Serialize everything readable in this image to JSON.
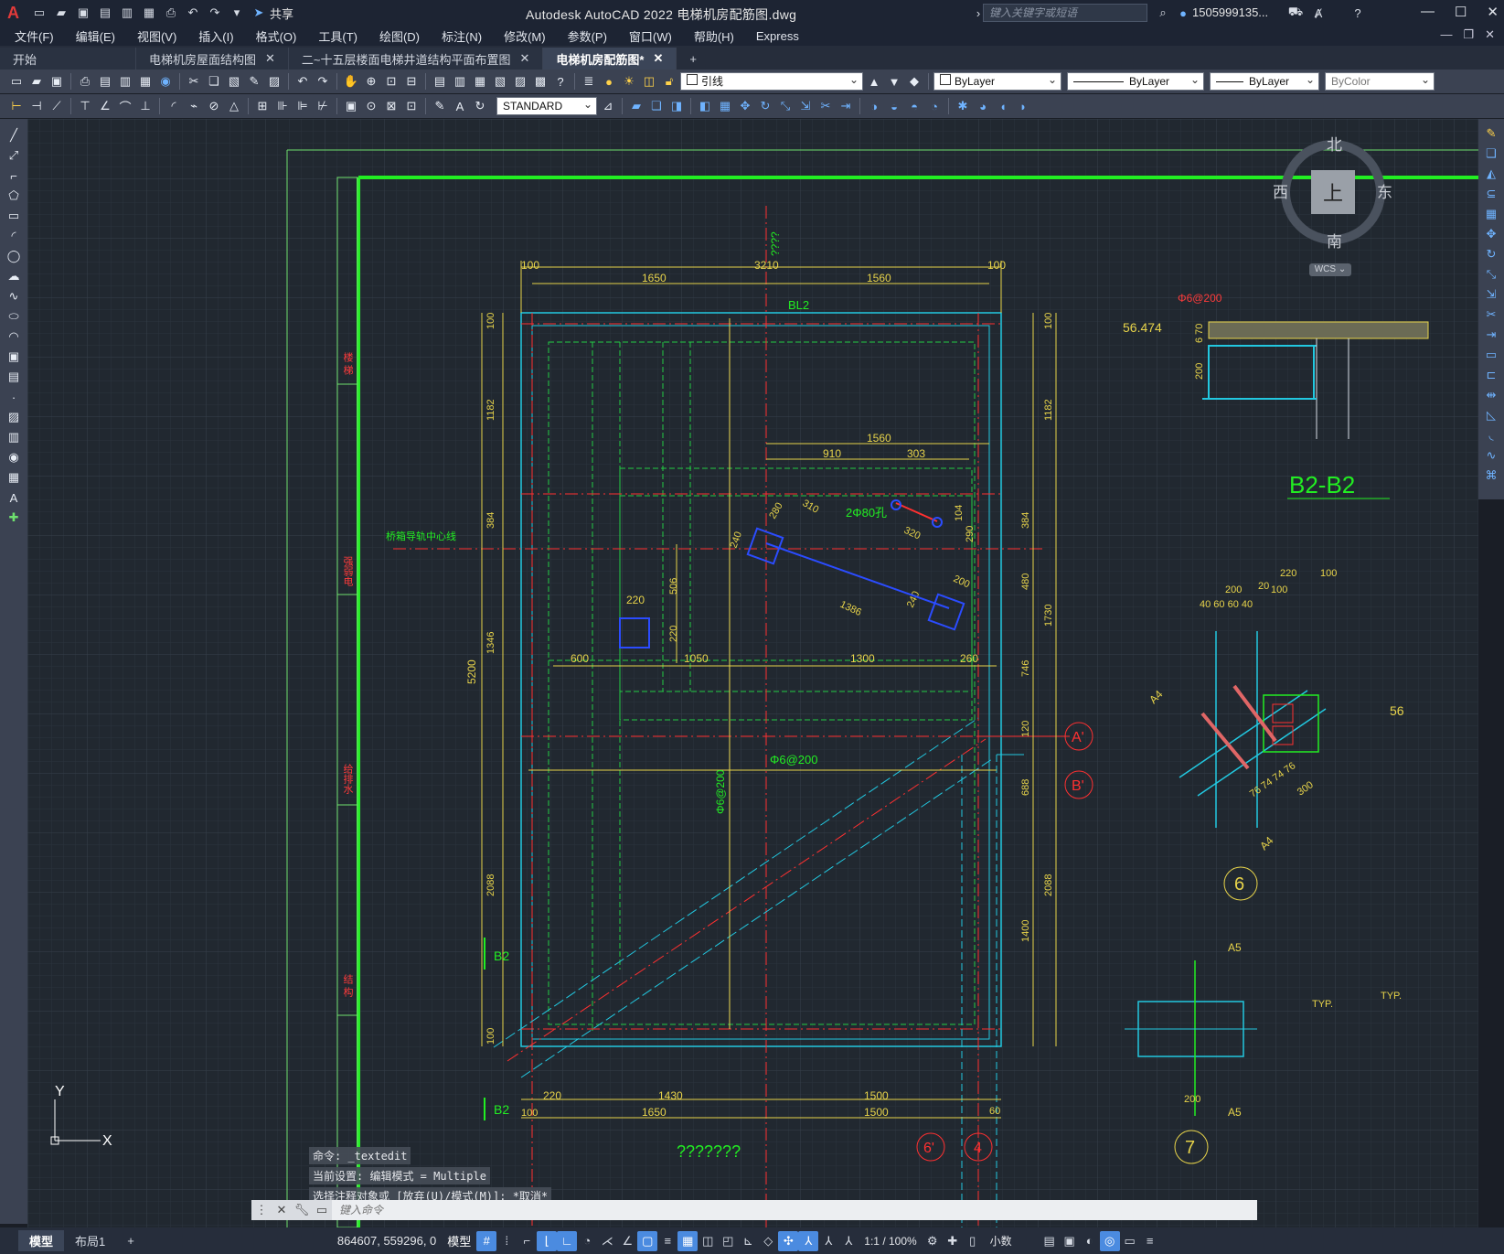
{
  "app": {
    "logo": "A",
    "title": "Autodesk AutoCAD 2022    电梯机房配筋图.dwg",
    "search_placeholder": "键入关键字或短语",
    "user": "1505999135...",
    "share_label": "共享"
  },
  "menu": [
    "文件(F)",
    "编辑(E)",
    "视图(V)",
    "插入(I)",
    "格式(O)",
    "工具(T)",
    "绘图(D)",
    "标注(N)",
    "修改(M)",
    "参数(P)",
    "窗口(W)",
    "帮助(H)",
    "Express"
  ],
  "tabs": [
    {
      "label": "开始"
    },
    {
      "label": "电梯机房屋面结构图"
    },
    {
      "label": "二~十五层楼面电梯井道结构平面布置图"
    },
    {
      "label": "电梯机房配筋图*"
    }
  ],
  "toolbar": {
    "layer": "引线",
    "color": "ByLayer",
    "linetype": "ByLayer",
    "lineweight": "ByLayer",
    "plotstyle": "ByColor",
    "textstyle": "STANDARD"
  },
  "viewcube": {
    "north": "北",
    "south": "南",
    "east": "东",
    "west": "西",
    "top": "上",
    "wcs": "WCS"
  },
  "ucs": {
    "x": "X",
    "y": "Y"
  },
  "drawing": {
    "title_b2": "B2-B2",
    "label_bl2": "BL2",
    "qmarks_top": "????",
    "top_total": "3210",
    "top_a": "1650",
    "top_b": "1560",
    "top_edge_l": "100",
    "top_edge_r": "100",
    "r_1560": "1560",
    "r_910": "910",
    "r_303": "303",
    "hole_label": "2Φ80孔",
    "d320": "320",
    "d280": "280",
    "d310": "310",
    "d240": "240",
    "d1386": "1386",
    "d200b": "200",
    "d240b": "240",
    "d104": "104",
    "d290": "290",
    "d220": "220",
    "d506": "506",
    "d220v": "220",
    "row600": "600",
    "row1050": "1050",
    "row1300": "1300",
    "row260": "260",
    "guide_line": "桥箱导轨中心线",
    "rebar1": "Φ6@200",
    "rebar2": "Φ6@200",
    "rebar3": "Φ6@200",
    "left_5200": "5200",
    "left_100a": "100",
    "left_1182": "1182",
    "left_384": "384",
    "left_1346": "1346",
    "left_2088": "2088",
    "left_100b": "100",
    "right_100": "100",
    "right_1182": "1182",
    "right_384": "384",
    "right_480": "480",
    "right_1730": "1730",
    "right_746": "746",
    "right_120": "120",
    "right_688": "688",
    "right_2088": "2088",
    "right_1400": "1400",
    "bot_220": "220",
    "bot_1430": "1430",
    "bot_1500a": "1500",
    "bot_1500b": "1500",
    "bot_1650": "1650",
    "bot_100": "100",
    "bot_60": "60",
    "b2_label1": "B2",
    "b2_label2": "B2",
    "circle_a": "A'",
    "circle_b": "B'",
    "circle_6": "6",
    "circle_7": "7",
    "circle_6p": "6'",
    "circle_4": "4",
    "elev": "56.474",
    "elev2": "56",
    "d670": "6 70",
    "d200c": "200",
    "j220": "220",
    "j100": "100",
    "j200": "200",
    "j20": "20",
    "j100b": "100",
    "j_row": "40 60 60 40",
    "a4a": "A4",
    "a4b": "A4",
    "a5a": "A5",
    "a5b": "A5",
    "j300": "300",
    "j74": "76  74  74  76",
    "j200b": "200",
    "typ": "TYP.",
    "typ2": "TYP.",
    "qmarks_bottom": "???????",
    "vlabels": [
      "楼 梯",
      "强弱电",
      "给排水",
      "结 构"
    ]
  },
  "command": {
    "history": [
      "命令: _textedit",
      "当前设置: 编辑模式 = Multiple",
      "选择注释对象或 [放弃(U)/模式(M)]: *取消*"
    ],
    "placeholder": "键入命令"
  },
  "status": {
    "tabs": [
      "模型",
      "布局1"
    ],
    "coords": "864607, 559296, 0",
    "model": "模型",
    "scale": "1:1 / 100%",
    "units": "小数"
  }
}
